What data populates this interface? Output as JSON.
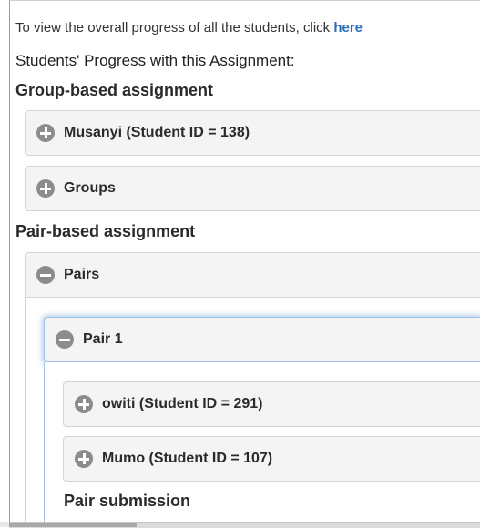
{
  "intro": {
    "text": "To view the overall progress of all the students, click ",
    "link": "here"
  },
  "progress_heading": "Students' Progress with this Assignment:",
  "group_section": {
    "heading": "Group-based assignment",
    "panels": [
      {
        "label": "Musanyi (Student ID = 138)",
        "state": "collapsed"
      },
      {
        "label": "Groups",
        "state": "collapsed"
      }
    ]
  },
  "pair_section": {
    "heading": "Pair-based assignment",
    "pairs_panel": {
      "label": "Pairs",
      "state": "expanded"
    },
    "pair1_panel": {
      "label": "Pair 1",
      "state": "expanded"
    },
    "students": [
      {
        "label": "owiti (Student ID = 291)",
        "state": "collapsed"
      },
      {
        "label": "Mumo (Student ID = 107)",
        "state": "collapsed"
      }
    ],
    "pair_submission_heading": "Pair submission"
  },
  "colors": {
    "link": "#2a6ebb",
    "panel_bg": "#f4f4f4",
    "toggle_icon": "#8c8c8c",
    "focus_glow": "#9ec3e6"
  }
}
